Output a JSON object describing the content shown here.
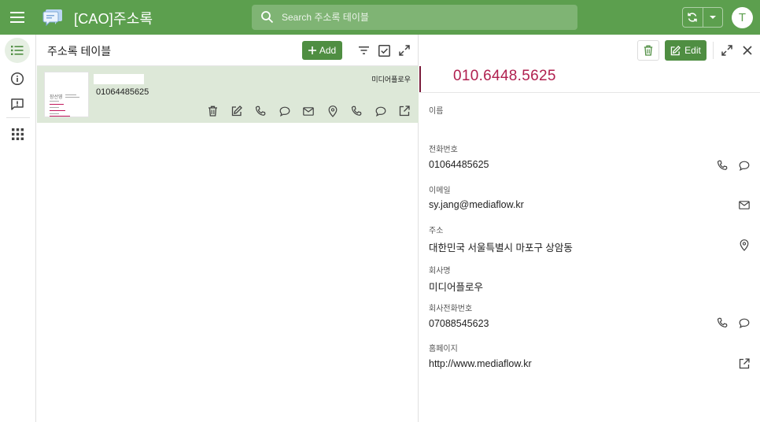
{
  "app": {
    "title": "[CAO]주소록",
    "search_placeholder": "Search 주소록 테이블",
    "user_initial": "T",
    "accent_color": "#5c9f4e",
    "button_color": "#4f8e42"
  },
  "rail": {
    "items": [
      {
        "icon": "list-icon",
        "active": true
      },
      {
        "icon": "info-icon",
        "active": false
      },
      {
        "icon": "feedback-icon",
        "active": false
      },
      {
        "icon": "apps-grid-icon",
        "active": false
      }
    ]
  },
  "list": {
    "title": "주소록 테이블",
    "add_label": "Add",
    "rows": [
      {
        "phone": "01064485625",
        "company": "미디어플로우",
        "card_name": "장선영"
      }
    ]
  },
  "detail": {
    "edit_label": "Edit",
    "card_phone": "010.6448.5625",
    "fields": [
      {
        "label": "이름",
        "value": ""
      },
      {
        "label": "전화번호",
        "value": "01064485625"
      },
      {
        "label": "이메일",
        "value": "sy.jang@mediaflow.kr"
      },
      {
        "label": "주소",
        "value": "대한민국 서울특별시 마포구 상암동"
      },
      {
        "label": "회사명",
        "value": "미디어플로우"
      },
      {
        "label": "회사전화번호",
        "value": "07088545623"
      },
      {
        "label": "홈페이지",
        "value": "http://www.mediaflow.kr"
      }
    ]
  }
}
